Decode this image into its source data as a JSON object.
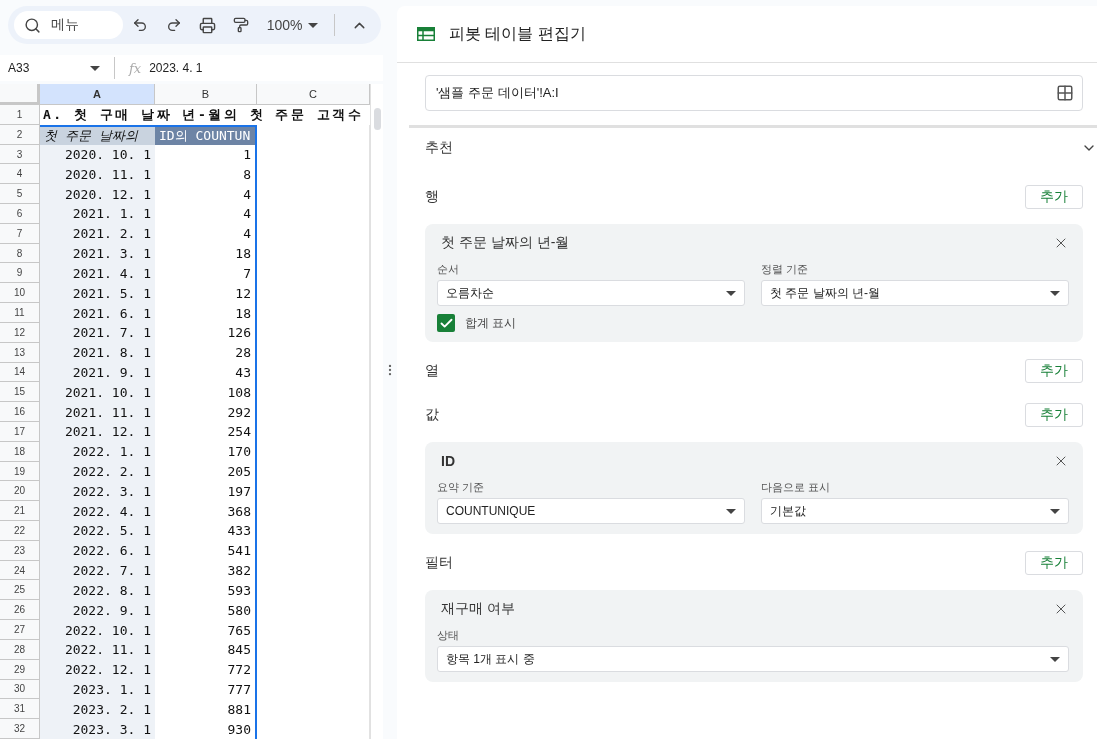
{
  "toolbar": {
    "search": "메뉴",
    "zoom": "100%"
  },
  "formula_bar": {
    "name_box": "A33",
    "fx": "fx",
    "formula": "2023. 4. 1"
  },
  "sheet": {
    "columns": [
      {
        "label": "A",
        "selected": true
      },
      {
        "label": "B",
        "selected": false
      },
      {
        "label": "C",
        "selected": false
      }
    ],
    "title_row": {
      "num": "1",
      "text": "A. 첫 구매 날짜 년-월의 첫 주문 고객수"
    },
    "header_row": {
      "num": "2",
      "a": "첫 주문 날짜의",
      "b": "ID의 COUNTUN"
    },
    "rows": [
      {
        "num": "3",
        "a": "2020. 10. 1",
        "b": "1"
      },
      {
        "num": "4",
        "a": "2020. 11. 1",
        "b": "8"
      },
      {
        "num": "5",
        "a": "2020. 12. 1",
        "b": "4"
      },
      {
        "num": "6",
        "a": "2021. 1. 1",
        "b": "4"
      },
      {
        "num": "7",
        "a": "2021. 2. 1",
        "b": "4"
      },
      {
        "num": "8",
        "a": "2021. 3. 1",
        "b": "18"
      },
      {
        "num": "9",
        "a": "2021. 4. 1",
        "b": "7"
      },
      {
        "num": "10",
        "a": "2021. 5. 1",
        "b": "12"
      },
      {
        "num": "11",
        "a": "2021. 6. 1",
        "b": "18"
      },
      {
        "num": "12",
        "a": "2021. 7. 1",
        "b": "126"
      },
      {
        "num": "13",
        "a": "2021. 8. 1",
        "b": "28"
      },
      {
        "num": "14",
        "a": "2021. 9. 1",
        "b": "43"
      },
      {
        "num": "15",
        "a": "2021. 10. 1",
        "b": "108"
      },
      {
        "num": "16",
        "a": "2021. 11. 1",
        "b": "292"
      },
      {
        "num": "17",
        "a": "2021. 12. 1",
        "b": "254"
      },
      {
        "num": "18",
        "a": "2022. 1. 1",
        "b": "170"
      },
      {
        "num": "19",
        "a": "2022. 2. 1",
        "b": "205"
      },
      {
        "num": "20",
        "a": "2022. 3. 1",
        "b": "197"
      },
      {
        "num": "21",
        "a": "2022. 4. 1",
        "b": "368"
      },
      {
        "num": "22",
        "a": "2022. 5. 1",
        "b": "433"
      },
      {
        "num": "23",
        "a": "2022. 6. 1",
        "b": "541"
      },
      {
        "num": "24",
        "a": "2022. 7. 1",
        "b": "382"
      },
      {
        "num": "25",
        "a": "2022. 8. 1",
        "b": "593"
      },
      {
        "num": "26",
        "a": "2022. 9. 1",
        "b": "580"
      },
      {
        "num": "27",
        "a": "2022. 10. 1",
        "b": "765"
      },
      {
        "num": "28",
        "a": "2022. 11. 1",
        "b": "845"
      },
      {
        "num": "29",
        "a": "2022. 12. 1",
        "b": "772"
      },
      {
        "num": "30",
        "a": "2023. 1. 1",
        "b": "777"
      },
      {
        "num": "31",
        "a": "2023. 2. 1",
        "b": "881"
      },
      {
        "num": "32",
        "a": "2023. 3. 1",
        "b": "930"
      }
    ]
  },
  "editor": {
    "title": "피봇 테이블 편집기",
    "range": "'샘플 주문 데이터'!A:I",
    "suggested": {
      "label": "추천",
      "expanded": false
    },
    "sections": [
      {
        "label": "행",
        "add": "추가",
        "cards": [
          {
            "title": "첫 주문 날짜의 년-월",
            "bold": false,
            "fields": [
              {
                "label": "순서",
                "value": "오름차순"
              },
              {
                "label": "정렬 기준",
                "value": "첫 주문 날짜의 년-월"
              }
            ],
            "checkbox": {
              "label": "합계 표시",
              "checked": true
            }
          }
        ]
      },
      {
        "label": "열",
        "add": "추가"
      },
      {
        "label": "값",
        "add": "추가",
        "cards": [
          {
            "title": "ID",
            "bold": true,
            "fields": [
              {
                "label": "요약 기준",
                "value": "COUNTUNIQUE"
              },
              {
                "label": "다음으로 표시",
                "value": "기본값"
              }
            ]
          }
        ]
      },
      {
        "label": "필터",
        "add": "추가",
        "cards": [
          {
            "title": "재구매 여부",
            "bold": false,
            "fields": [
              {
                "label": "상태",
                "value": "항목 1개 표시 중"
              }
            ]
          }
        ]
      }
    ]
  }
}
